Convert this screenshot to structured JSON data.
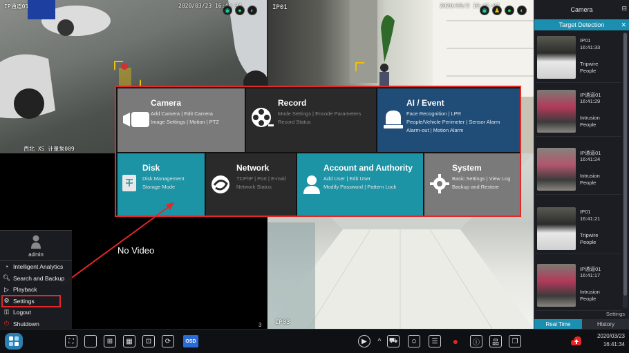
{
  "panes": [
    {
      "label": "IP通道01",
      "timestamp": "2020/03/23 16:41:34",
      "caption": "西北 XS 计量泵009",
      "number": ""
    },
    {
      "label": "IP01",
      "timestamp": "2020/03/2 16:41:07",
      "number": ""
    },
    {
      "label": "",
      "no_video": "No Video",
      "number": "3"
    },
    {
      "label": "IP03",
      "number": ""
    }
  ],
  "side_panel": {
    "title": "Camera",
    "tab": "Target Detection",
    "detections": [
      {
        "id": "IP01",
        "time": "16:41:33",
        "type": "Tripwire",
        "class": "People"
      },
      {
        "id": "IP通道01",
        "time": "16:41:29",
        "type": "Intrusion",
        "class": "People"
      },
      {
        "id": "IP通道01",
        "time": "16:41:24",
        "type": "Intrusion",
        "class": "People"
      },
      {
        "id": "IP01",
        "time": "16:41:21",
        "type": "Tripwire",
        "class": "People"
      },
      {
        "id": "IP通道01",
        "time": "16:41:17",
        "type": "Intrusion",
        "class": "People"
      }
    ],
    "settings_link": "Settings",
    "tabs": {
      "realtime": "Real Time",
      "history": "History"
    }
  },
  "settings_menu": {
    "camera": {
      "title": "Camera",
      "line1a": "Add Camera",
      "line1b": "Edit Camera",
      "line2a": "Image Settings",
      "line2b": "Motion",
      "line2c": "PTZ"
    },
    "record": {
      "title": "Record",
      "line1a": "Mode Settings",
      "line1b": "Encode Parameters",
      "line2": "Record Status"
    },
    "ai": {
      "title": "AI / Event",
      "line1a": "Face Recognition",
      "line1b": "LPR",
      "line2a": "People/Vehicle Perimeter",
      "line2b": "Sensor Alarm",
      "line3a": "Alarm-out",
      "line3b": "Motion Alarm"
    },
    "disk": {
      "title": "Disk",
      "line1": "Disk Management",
      "line2": "Storage Mode"
    },
    "network": {
      "title": "Network",
      "line1a": "TCP/IP",
      "line1b": "Port",
      "line1c": "E-mail",
      "line2": "Network Status"
    },
    "account": {
      "title": "Account and Authority",
      "line1a": "Add User",
      "line1b": "Edit User",
      "line2a": "Modify Password",
      "line2b": "Pattern Lock"
    },
    "system": {
      "title": "System",
      "line1a": "Basic Settings",
      "line1b": "View Log",
      "line2": "Backup and Restore"
    }
  },
  "start_menu": {
    "user": "admin",
    "items": [
      "Intelligent Analytics",
      "Search and Backup",
      "Playback",
      "Settings",
      "Logout",
      "Shutdown"
    ]
  },
  "taskbar": {
    "osd": "OSD",
    "date": "2020/03/23",
    "time": "16:41:34"
  },
  "colors": {
    "accent": "#1c8fb0",
    "highlight": "#e42727",
    "ai_tile": "#1f4d77",
    "teal_tile": "#1d93a6"
  }
}
